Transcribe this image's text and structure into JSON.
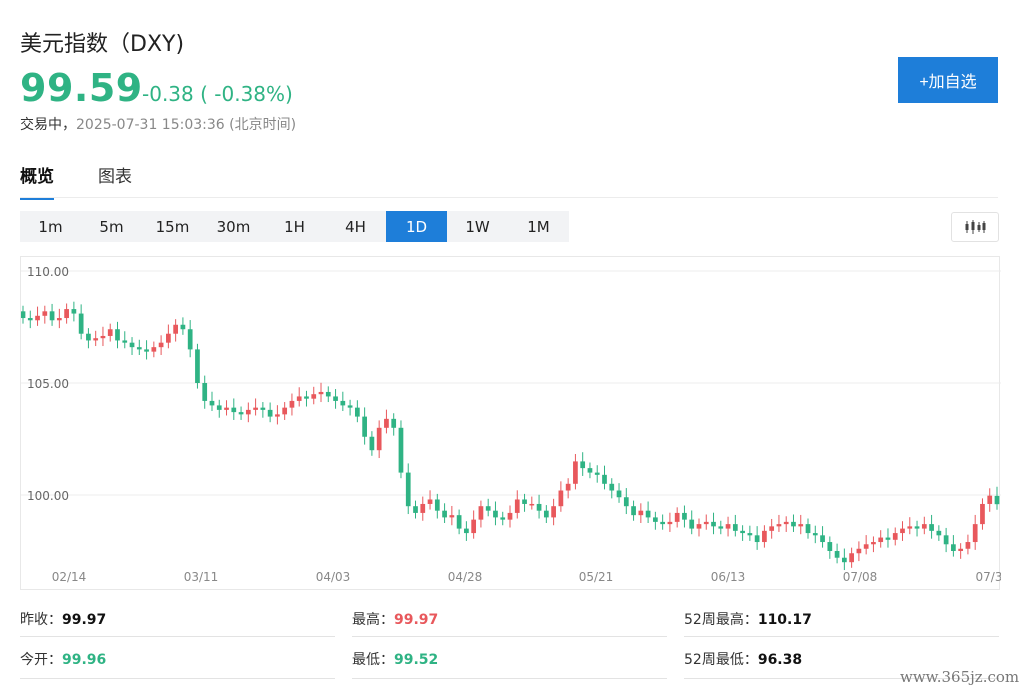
{
  "header": {
    "title": "美元指数（DXY)",
    "price": "99.59",
    "change": "-0.38 ( -0.38%)",
    "status": "交易中，",
    "timestamp": "2025-07-31 15:03:36",
    "timezone": "(北京时间)",
    "add_button": "+加自选"
  },
  "tabs": [
    {
      "label": "概览",
      "active": true
    },
    {
      "label": "图表",
      "active": false
    }
  ],
  "periods": [
    {
      "label": "1m",
      "active": false
    },
    {
      "label": "5m",
      "active": false
    },
    {
      "label": "15m",
      "active": false
    },
    {
      "label": "30m",
      "active": false
    },
    {
      "label": "1H",
      "active": false
    },
    {
      "label": "4H",
      "active": false
    },
    {
      "label": "1D",
      "active": true
    },
    {
      "label": "1W",
      "active": false
    },
    {
      "label": "1M",
      "active": false
    }
  ],
  "chart_type_icon": "candlestick-icon",
  "colors": {
    "up": "#e8585c",
    "down": "#2fb384",
    "accent": "#1e7ed9"
  },
  "chart_data": {
    "type": "candlestick",
    "y_ticks": [
      "110.00",
      "105.00",
      "100.00"
    ],
    "x_ticks": [
      "02/14",
      "03/11",
      "04/03",
      "04/28",
      "05/21",
      "06/13",
      "07/08",
      "07/3"
    ],
    "ylim": [
      97.0,
      110.5
    ],
    "grid": true,
    "closes": [
      107.9,
      107.8,
      108.0,
      108.2,
      107.8,
      107.9,
      108.3,
      108.1,
      107.2,
      106.9,
      107.0,
      107.1,
      107.4,
      106.9,
      106.8,
      106.6,
      106.5,
      106.4,
      106.6,
      106.8,
      107.2,
      107.6,
      107.4,
      106.5,
      105.0,
      104.2,
      104.0,
      103.8,
      103.9,
      103.7,
      103.6,
      103.8,
      103.9,
      103.8,
      103.5,
      103.6,
      103.9,
      104.2,
      104.4,
      104.3,
      104.5,
      104.6,
      104.4,
      104.2,
      104.0,
      103.9,
      103.5,
      102.6,
      102.0,
      103.0,
      103.4,
      103.0,
      101.0,
      99.5,
      99.2,
      99.6,
      99.8,
      99.3,
      99.0,
      99.1,
      98.5,
      98.3,
      98.9,
      99.5,
      99.3,
      99.0,
      98.9,
      99.2,
      99.8,
      99.6,
      99.6,
      99.3,
      99.0,
      99.5,
      100.2,
      100.5,
      101.5,
      101.2,
      101.0,
      100.9,
      100.5,
      100.2,
      99.9,
      99.5,
      99.1,
      99.3,
      99.0,
      98.8,
      98.7,
      98.8,
      99.2,
      98.9,
      98.5,
      98.7,
      98.8,
      98.6,
      98.5,
      98.7,
      98.4,
      98.3,
      98.2,
      97.9,
      98.4,
      98.6,
      98.7,
      98.8,
      98.6,
      98.7,
      98.3,
      98.2,
      97.9,
      97.5,
      97.2,
      97.0,
      97.4,
      97.6,
      97.8,
      97.9,
      98.1,
      98.0,
      98.3,
      98.5,
      98.6,
      98.5,
      98.7,
      98.4,
      98.2,
      97.8,
      97.5,
      97.6,
      97.9,
      98.7,
      99.6,
      99.97,
      99.59
    ],
    "opens": [
      108.2,
      107.9,
      107.8,
      108.0,
      108.2,
      107.8,
      107.9,
      108.3,
      108.1,
      107.2,
      106.9,
      107.0,
      107.1,
      107.4,
      106.9,
      106.8,
      106.6,
      106.5,
      106.4,
      106.6,
      106.8,
      107.2,
      107.6,
      107.4,
      106.5,
      105.0,
      104.2,
      104.0,
      103.8,
      103.9,
      103.7,
      103.6,
      103.8,
      103.9,
      103.8,
      103.5,
      103.6,
      103.9,
      104.2,
      104.4,
      104.3,
      104.5,
      104.6,
      104.4,
      104.2,
      104.0,
      103.9,
      103.5,
      102.6,
      102.0,
      103.0,
      103.4,
      103.0,
      101.0,
      99.5,
      99.2,
      99.6,
      99.8,
      99.3,
      99.0,
      99.1,
      98.5,
      98.3,
      98.9,
      99.5,
      99.3,
      99.0,
      98.9,
      99.2,
      99.8,
      99.6,
      99.6,
      99.3,
      99.0,
      99.5,
      100.2,
      100.5,
      101.5,
      101.2,
      101.0,
      100.9,
      100.5,
      100.2,
      99.9,
      99.5,
      99.1,
      99.3,
      99.0,
      98.8,
      98.7,
      98.8,
      99.2,
      98.9,
      98.5,
      98.7,
      98.8,
      98.6,
      98.5,
      98.7,
      98.4,
      98.3,
      98.2,
      97.9,
      98.4,
      98.6,
      98.7,
      98.8,
      98.6,
      98.7,
      98.3,
      98.2,
      97.9,
      97.5,
      97.2,
      97.0,
      97.4,
      97.6,
      97.8,
      97.9,
      98.1,
      98.0,
      98.3,
      98.5,
      98.6,
      98.5,
      98.7,
      98.4,
      98.2,
      97.8,
      97.5,
      97.6,
      97.9,
      98.7,
      99.6,
      99.96
    ]
  },
  "stats": {
    "prev_close_label": "昨收：",
    "prev_close": "99.97",
    "high_label": "最高：",
    "high": "99.97",
    "w52_high_label": "52周最高：",
    "w52_high": "110.17",
    "open_label": "今开：",
    "open": "99.96",
    "low_label": "最低：",
    "low": "99.52",
    "w52_low_label": "52周最低：",
    "w52_low": "96.38"
  },
  "watermark": "www.365jz.com"
}
